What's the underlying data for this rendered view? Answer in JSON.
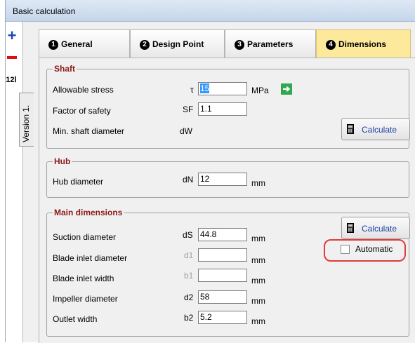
{
  "window": {
    "title": "Basic calculation"
  },
  "toolbar": {
    "add_icon": "plus-icon",
    "remove_icon": "minus-icon",
    "units_label": "12Ⅰ"
  },
  "version_tab": {
    "label": "Version 1."
  },
  "tabs": [
    {
      "num": "1",
      "label": "General",
      "active": false
    },
    {
      "num": "2",
      "label": "Design Point",
      "active": false
    },
    {
      "num": "3",
      "label": "Parameters",
      "active": false
    },
    {
      "num": "4",
      "label": "Dimensions",
      "active": true
    }
  ],
  "shaft": {
    "title": "Shaft",
    "allowable_stress": {
      "label": "Allowable stress",
      "symbol": "τ",
      "value": "15",
      "unit": "MPa"
    },
    "factor_of_safety": {
      "label": "Factor of safety",
      "symbol": "SF",
      "value": "1.1"
    },
    "min_shaft_diameter": {
      "label": "Min. shaft diameter",
      "symbol": "dW"
    },
    "calculate_label": "Calculate"
  },
  "hub": {
    "title": "Hub",
    "hub_diameter": {
      "label": "Hub diameter",
      "symbol": "dN",
      "value": "12",
      "unit": "mm"
    }
  },
  "main": {
    "title": "Main dimensions",
    "calculate_label": "Calculate",
    "automatic_label": "Automatic",
    "automatic_checked": false,
    "rows": [
      {
        "label": "Suction diameter",
        "symbol": "dS",
        "value": "44.8",
        "unit": "mm",
        "enabled": true
      },
      {
        "label": "Blade inlet diameter",
        "symbol": "d1",
        "value": "",
        "unit": "mm",
        "enabled": false
      },
      {
        "label": "Blade inlet width",
        "symbol": "b1",
        "value": "",
        "unit": "mm",
        "enabled": false
      },
      {
        "label": "Impeller diameter",
        "symbol": "d2",
        "value": "58",
        "unit": "mm",
        "enabled": true
      },
      {
        "label": "Outlet width",
        "symbol": "b2",
        "value": "5.2",
        "unit": "mm",
        "enabled": true
      }
    ]
  },
  "colors": {
    "active_tab": "#fde99c",
    "group_title": "#8b1a1a",
    "highlight_ring": "#e23b3b",
    "button_text": "#1f3fa8"
  }
}
